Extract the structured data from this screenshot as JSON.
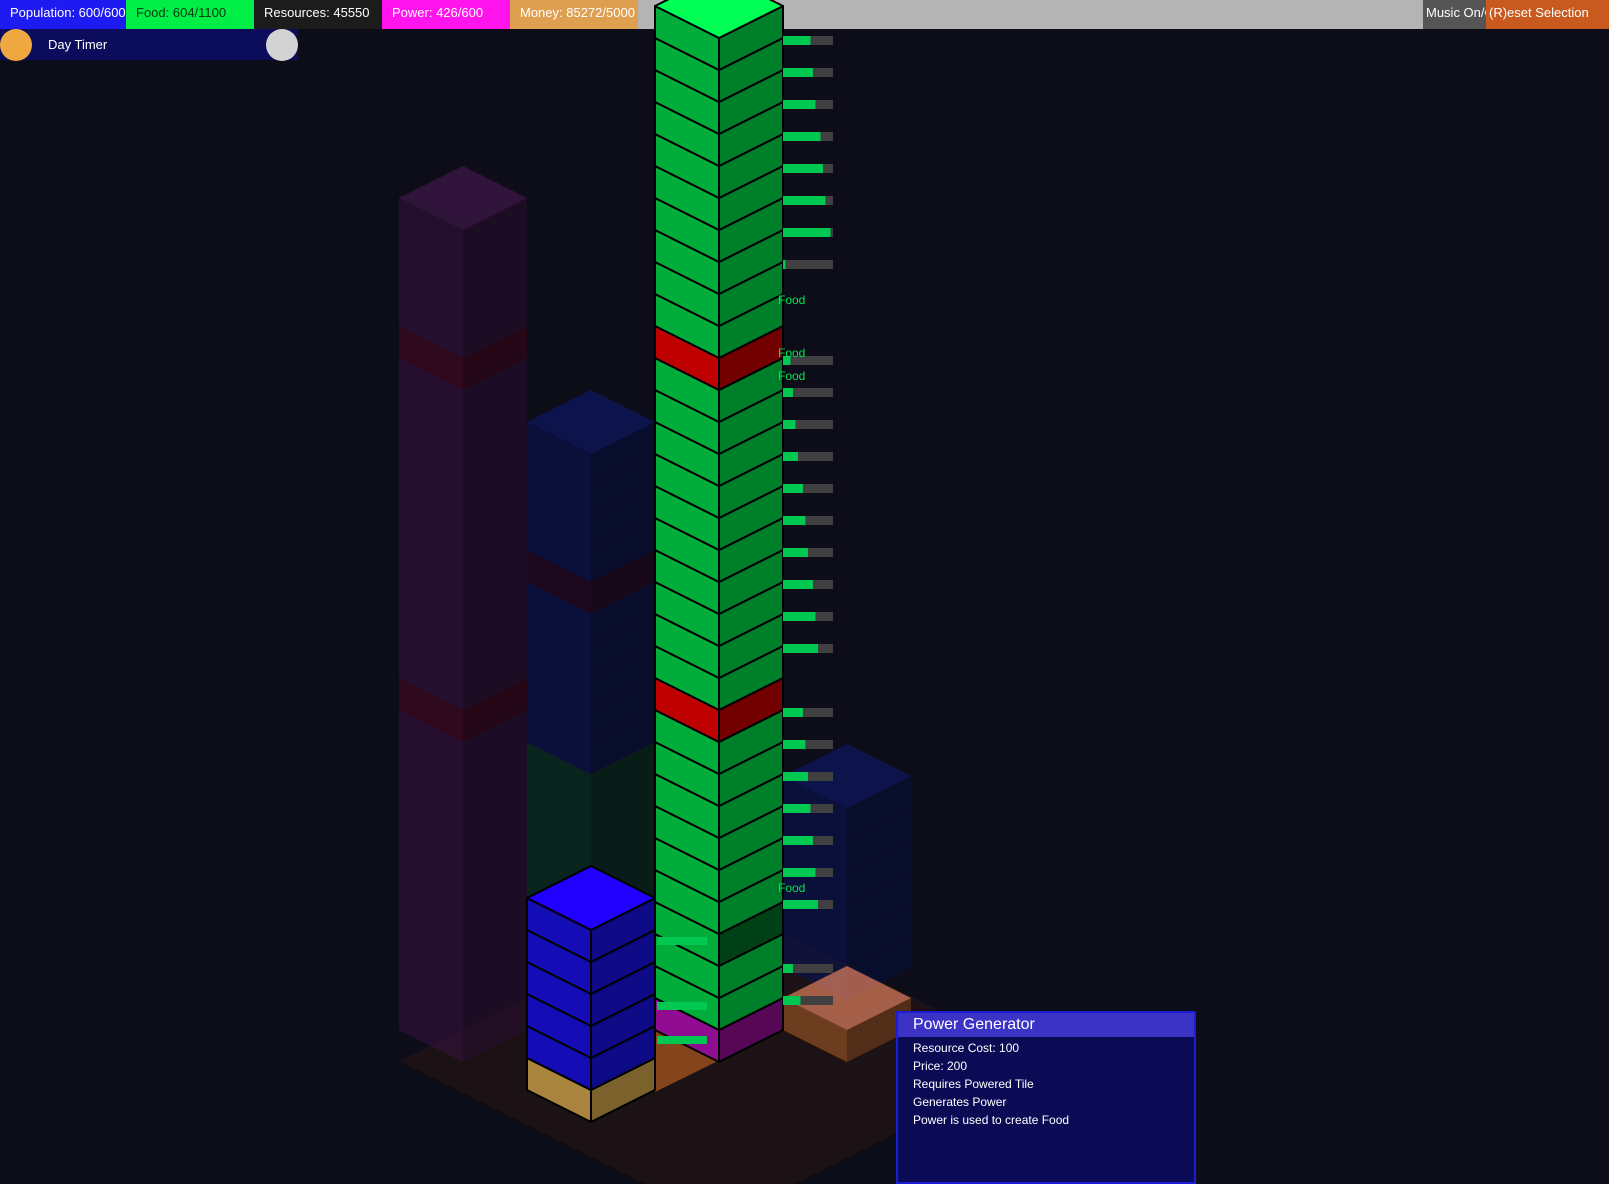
{
  "topbar": {
    "stats": [
      {
        "name": "population-stat",
        "label": "Population: 600/600",
        "bg": "#1d1af2",
        "fg": "#ffffff"
      },
      {
        "name": "food-stat",
        "label": "Food: 604/1100",
        "bg": "#00ee45",
        "fg": "#0a3a10"
      },
      {
        "name": "resources-stat",
        "label": "Resources: 45550",
        "bg": "#1c1c1c",
        "fg": "#ffffff"
      },
      {
        "name": "power-stat",
        "label": "Power: 426/600",
        "bg": "#ff14ee",
        "fg": "#ffffff"
      },
      {
        "name": "money-stat",
        "label": "Money: 85272/5000",
        "bg": "#dea050",
        "fg": "#ffffff"
      }
    ],
    "music_label": "Music On/Off",
    "reset_label": "(R)eset Selection",
    "music_bg": "#555555",
    "reset_bg": "#c95a1f"
  },
  "day_timer": {
    "label": "Day Timer",
    "sun_color": "#efa73f",
    "moon_color": "#d3d3d3"
  },
  "floating_labels": [
    "Food",
    "Food",
    "Food",
    "Food"
  ],
  "tooltip": {
    "title": "Power Generator",
    "lines": [
      "Resource Cost: 100",
      "Price: 200",
      "Requires Powered Tile",
      "Generates Power",
      "Power is used to create Food"
    ]
  },
  "colors": {
    "food_block": "#00e64d",
    "power_block": "#ff0000",
    "housing_block": "#1a10f0",
    "ground_block": "#e0b050",
    "selection_block": "#c010c0",
    "progress_fill": "#00c850",
    "progress_track": "#404040"
  },
  "tower": {
    "food_progress": [
      0.55,
      0.6,
      0.65,
      0.75,
      0.8,
      0.85,
      0.95,
      0.05,
      null,
      null,
      0.15,
      0.2,
      0.25,
      0.3,
      0.4,
      0.45,
      0.5,
      0.6,
      0.65,
      0.7,
      null,
      0.4,
      0.45,
      0.5,
      0.55,
      0.6,
      0.65,
      0.7,
      null,
      0.2,
      0.35
    ]
  }
}
